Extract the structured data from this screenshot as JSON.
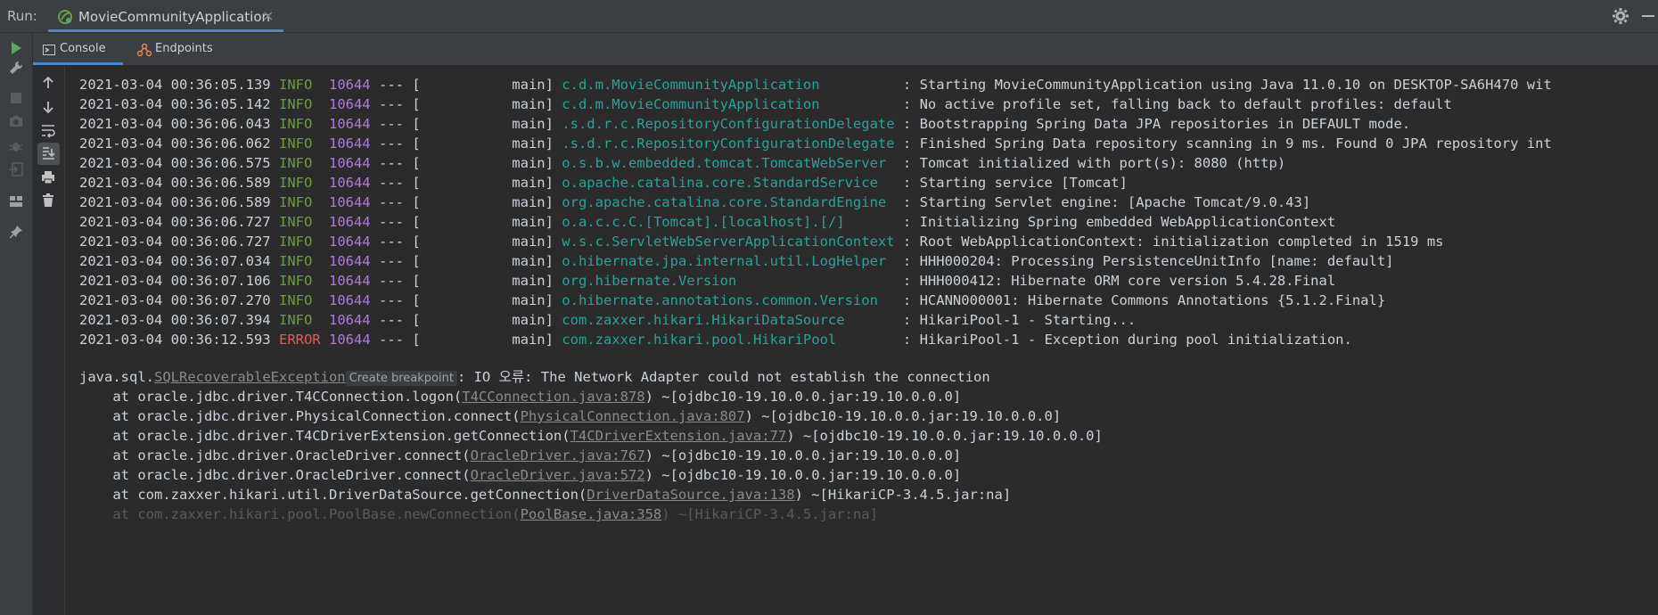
{
  "runbar": {
    "label": "Run:",
    "tab_title": "MovieCommunityApplication",
    "close_glyph": "×",
    "icons": [
      "spring-run-icon",
      "gear-icon",
      "minimize-icon"
    ]
  },
  "tabs": [
    {
      "label": "Console",
      "icon": "console-icon"
    },
    {
      "label": "Endpoints",
      "icon": "endpoints-icon"
    }
  ],
  "left_toolbar_icons": [
    "run-icon",
    "wrench-icon",
    "stop-icon",
    "camera-icon",
    "debug-icon",
    "exit-icon",
    "layout-icon",
    "pin-icon"
  ],
  "console_toolbar_icons": [
    "arrow-up-icon",
    "arrow-down-icon",
    "soft-wrap-icon",
    "scroll-to-end-icon",
    "print-icon",
    "trash-icon"
  ],
  "log": [
    {
      "ts": "2021-03-04 00:36:05.139",
      "level": "INFO",
      "pid": "10644",
      "thread": "main",
      "logger": "c.d.m.MovieCommunityApplication",
      "msg": "Starting MovieCommunityApplication using Java 11.0.10 on DESKTOP-SA6H470 wit"
    },
    {
      "ts": "2021-03-04 00:36:05.142",
      "level": "INFO",
      "pid": "10644",
      "thread": "main",
      "logger": "c.d.m.MovieCommunityApplication",
      "msg": "No active profile set, falling back to default profiles: default"
    },
    {
      "ts": "2021-03-04 00:36:06.043",
      "level": "INFO",
      "pid": "10644",
      "thread": "main",
      "logger": ".s.d.r.c.RepositoryConfigurationDelegate",
      "msg": "Bootstrapping Spring Data JPA repositories in DEFAULT mode."
    },
    {
      "ts": "2021-03-04 00:36:06.062",
      "level": "INFO",
      "pid": "10644",
      "thread": "main",
      "logger": ".s.d.r.c.RepositoryConfigurationDelegate",
      "msg": "Finished Spring Data repository scanning in 9 ms. Found 0 JPA repository int"
    },
    {
      "ts": "2021-03-04 00:36:06.575",
      "level": "INFO",
      "pid": "10644",
      "thread": "main",
      "logger": "o.s.b.w.embedded.tomcat.TomcatWebServer",
      "msg": "Tomcat initialized with port(s): 8080 (http)"
    },
    {
      "ts": "2021-03-04 00:36:06.589",
      "level": "INFO",
      "pid": "10644",
      "thread": "main",
      "logger": "o.apache.catalina.core.StandardService",
      "msg": "Starting service [Tomcat]"
    },
    {
      "ts": "2021-03-04 00:36:06.589",
      "level": "INFO",
      "pid": "10644",
      "thread": "main",
      "logger": "org.apache.catalina.core.StandardEngine",
      "msg": "Starting Servlet engine: [Apache Tomcat/9.0.43]"
    },
    {
      "ts": "2021-03-04 00:36:06.727",
      "level": "INFO",
      "pid": "10644",
      "thread": "main",
      "logger": "o.a.c.c.C.[Tomcat].[localhost].[/]",
      "msg": "Initializing Spring embedded WebApplicationContext"
    },
    {
      "ts": "2021-03-04 00:36:06.727",
      "level": "INFO",
      "pid": "10644",
      "thread": "main",
      "logger": "w.s.c.ServletWebServerApplicationContext",
      "msg": "Root WebApplicationContext: initialization completed in 1519 ms"
    },
    {
      "ts": "2021-03-04 00:36:07.034",
      "level": "INFO",
      "pid": "10644",
      "thread": "main",
      "logger": "o.hibernate.jpa.internal.util.LogHelper",
      "msg": "HHH000204: Processing PersistenceUnitInfo [name: default]"
    },
    {
      "ts": "2021-03-04 00:36:07.106",
      "level": "INFO",
      "pid": "10644",
      "thread": "main",
      "logger": "org.hibernate.Version",
      "msg": "HHH000412: Hibernate ORM core version 5.4.28.Final"
    },
    {
      "ts": "2021-03-04 00:36:07.270",
      "level": "INFO",
      "pid": "10644",
      "thread": "main",
      "logger": "o.hibernate.annotations.common.Version",
      "msg": "HCANN000001: Hibernate Commons Annotations {5.1.2.Final}"
    },
    {
      "ts": "2021-03-04 00:36:07.394",
      "level": "INFO",
      "pid": "10644",
      "thread": "main",
      "logger": "com.zaxxer.hikari.HikariDataSource",
      "msg": "HikariPool-1 - Starting..."
    },
    {
      "ts": "2021-03-04 00:36:12.593",
      "level": "ERROR",
      "pid": "10644",
      "thread": "main",
      "logger": "com.zaxxer.hikari.pool.HikariPool",
      "msg": "HikariPool-1 - Exception during pool initialization."
    }
  ],
  "exception": {
    "prefix": "java.sql.",
    "class": "SQLRecoverableException",
    "breakpoint_label": "Create breakpoint",
    "message": ": IO 오류: The Network Adapter could not establish the connection"
  },
  "stack": [
    {
      "pre": "at oracle.jdbc.driver.T4CConnection.logon(",
      "link": "T4CConnection.java:878",
      "post": ") ~[ojdbc10-19.10.0.0.jar:19.10.0.0.0]"
    },
    {
      "pre": "at oracle.jdbc.driver.PhysicalConnection.connect(",
      "link": "PhysicalConnection.java:807",
      "post": ") ~[ojdbc10-19.10.0.0.jar:19.10.0.0.0]"
    },
    {
      "pre": "at oracle.jdbc.driver.T4CDriverExtension.getConnection(",
      "link": "T4CDriverExtension.java:77",
      "post": ") ~[ojdbc10-19.10.0.0.jar:19.10.0.0.0]"
    },
    {
      "pre": "at oracle.jdbc.driver.OracleDriver.connect(",
      "link": "OracleDriver.java:767",
      "post": ") ~[ojdbc10-19.10.0.0.jar:19.10.0.0.0]"
    },
    {
      "pre": "at oracle.jdbc.driver.OracleDriver.connect(",
      "link": "OracleDriver.java:572",
      "post": ") ~[ojdbc10-19.10.0.0.jar:19.10.0.0.0]"
    },
    {
      "pre": "at com.zaxxer.hikari.util.DriverDataSource.getConnection(",
      "link": "DriverDataSource.java:138",
      "post": ") ~[HikariCP-3.4.5.jar:na]"
    },
    {
      "pre": "at com.zaxxer.hikari.pool.PoolBase.newConnection(",
      "link": "PoolBase.java:358",
      "post": ") ~[HikariCP-3.4.5.jar:na]"
    }
  ],
  "colors": {
    "info": "#6a9a44",
    "error": "#e05a5a",
    "pid": "#b07ad6",
    "logger": "#2aa198",
    "accent": "#4a88c7"
  }
}
